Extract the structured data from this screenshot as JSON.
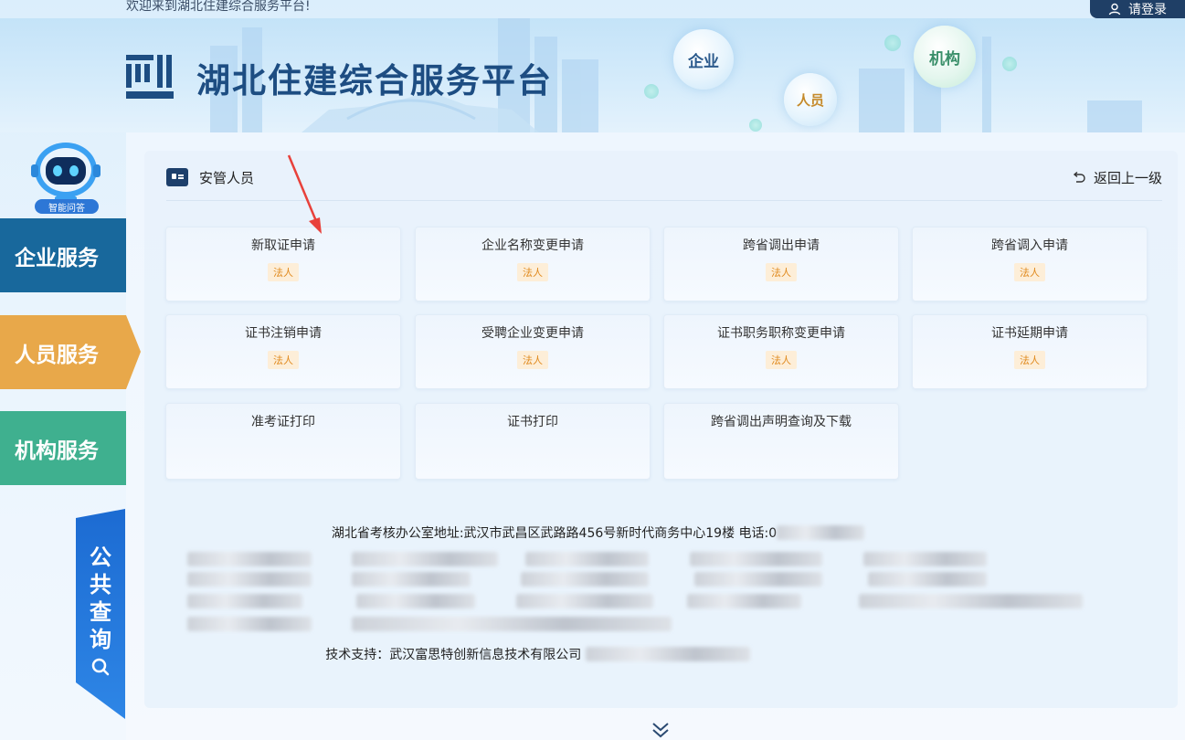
{
  "topbar": {
    "welcome": "欢迎来到湖北住建综合服务平台!",
    "login": "请登录"
  },
  "header": {
    "title": "湖北住建综合服务平台",
    "bubbles": [
      "企业",
      "人员",
      "机构"
    ]
  },
  "sidebar": {
    "robot_label": "智能问答",
    "items": [
      {
        "label": "企业服务"
      },
      {
        "label": "人员服务"
      },
      {
        "label": "机构服务"
      }
    ],
    "public_query": [
      "公",
      "共",
      "查",
      "询"
    ]
  },
  "section": {
    "title": "安管人员",
    "back": "返回上一级"
  },
  "tiles": [
    {
      "title": "新取证申请",
      "badge": "法人"
    },
    {
      "title": "企业名称变更申请",
      "badge": "法人"
    },
    {
      "title": "跨省调出申请",
      "badge": "法人"
    },
    {
      "title": "跨省调入申请",
      "badge": "法人"
    },
    {
      "title": "证书注销申请",
      "badge": "法人"
    },
    {
      "title": "受聘企业变更申请",
      "badge": "法人"
    },
    {
      "title": "证书职务职称变更申请",
      "badge": "法人"
    },
    {
      "title": "证书延期申请",
      "badge": "法人"
    },
    {
      "title": "准考证打印",
      "badge": ""
    },
    {
      "title": "证书打印",
      "badge": ""
    },
    {
      "title": "跨省调出声明查询及下载",
      "badge": ""
    }
  ],
  "footer": {
    "address": "湖北省考核办公室地址:武汉市武昌区武路路456号新时代商务中心19楼 电话:0",
    "support": "技术支持：武汉富思特创新信息技术有限公司 ",
    "partial": [
      "8",
      "荆门 0724-6060000",
      "黄石 0714-6567070",
      "/77859",
      "潜",
      "天",
      "荆",
      "77"
    ]
  },
  "colors": {
    "nav_enterprise": "#18689c",
    "nav_personnel": "#e8a84a",
    "nav_org": "#3fb08f",
    "badge_text": "#e08a1e",
    "public_query": "#1c6bd2"
  }
}
